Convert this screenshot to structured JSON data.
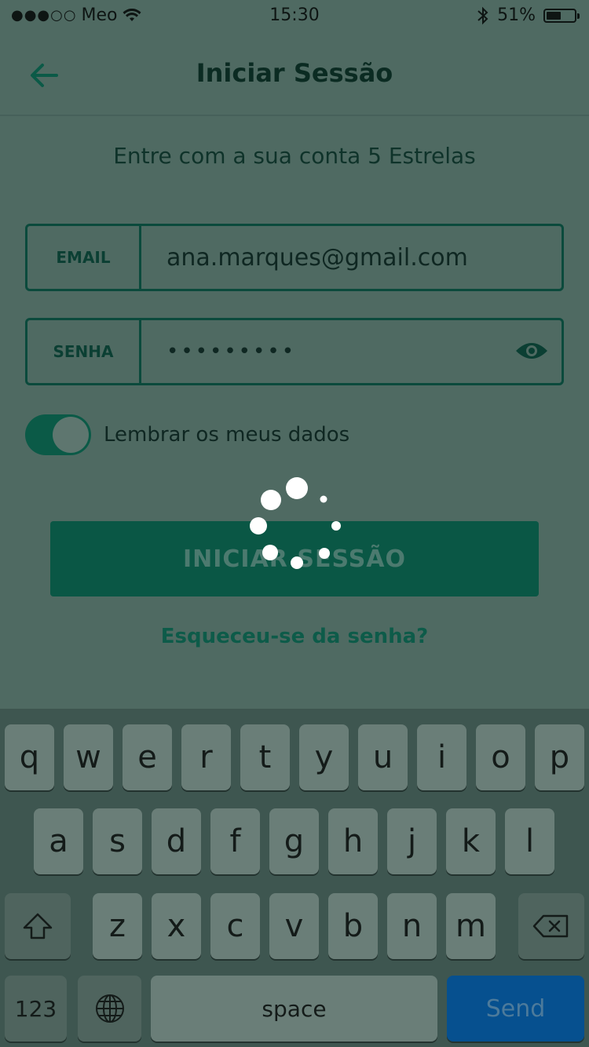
{
  "status_bar": {
    "signal": "●●●○○",
    "carrier": "Meo",
    "time": "15:30",
    "battery": "51%"
  },
  "header": {
    "title": "Iniciar Sessão",
    "back_icon": "arrow-left-icon"
  },
  "subtitle": "Entre com a sua conta 5 Estrelas",
  "email": {
    "label": "EMAIL",
    "value": "ana.marques@gmail.com"
  },
  "password": {
    "label": "SENHA",
    "value": "•••••••••",
    "toggle_icon": "eye-icon"
  },
  "remember": {
    "label": "Lembrar os meus dados",
    "on": true
  },
  "login_button": "INICIAR SESSÃO",
  "forgot_link": "Esqueceu-se da senha?",
  "keyboard": {
    "row1": [
      "q",
      "w",
      "e",
      "r",
      "t",
      "y",
      "u",
      "i",
      "o",
      "p"
    ],
    "row2": [
      "a",
      "s",
      "d",
      "f",
      "g",
      "h",
      "j",
      "k",
      "l"
    ],
    "row3": [
      "z",
      "x",
      "c",
      "v",
      "b",
      "n",
      "m"
    ],
    "numbers": "123",
    "space": "space",
    "send": "Send"
  },
  "colors": {
    "accent": "#0a5745",
    "overlay": "#4f6a62"
  }
}
